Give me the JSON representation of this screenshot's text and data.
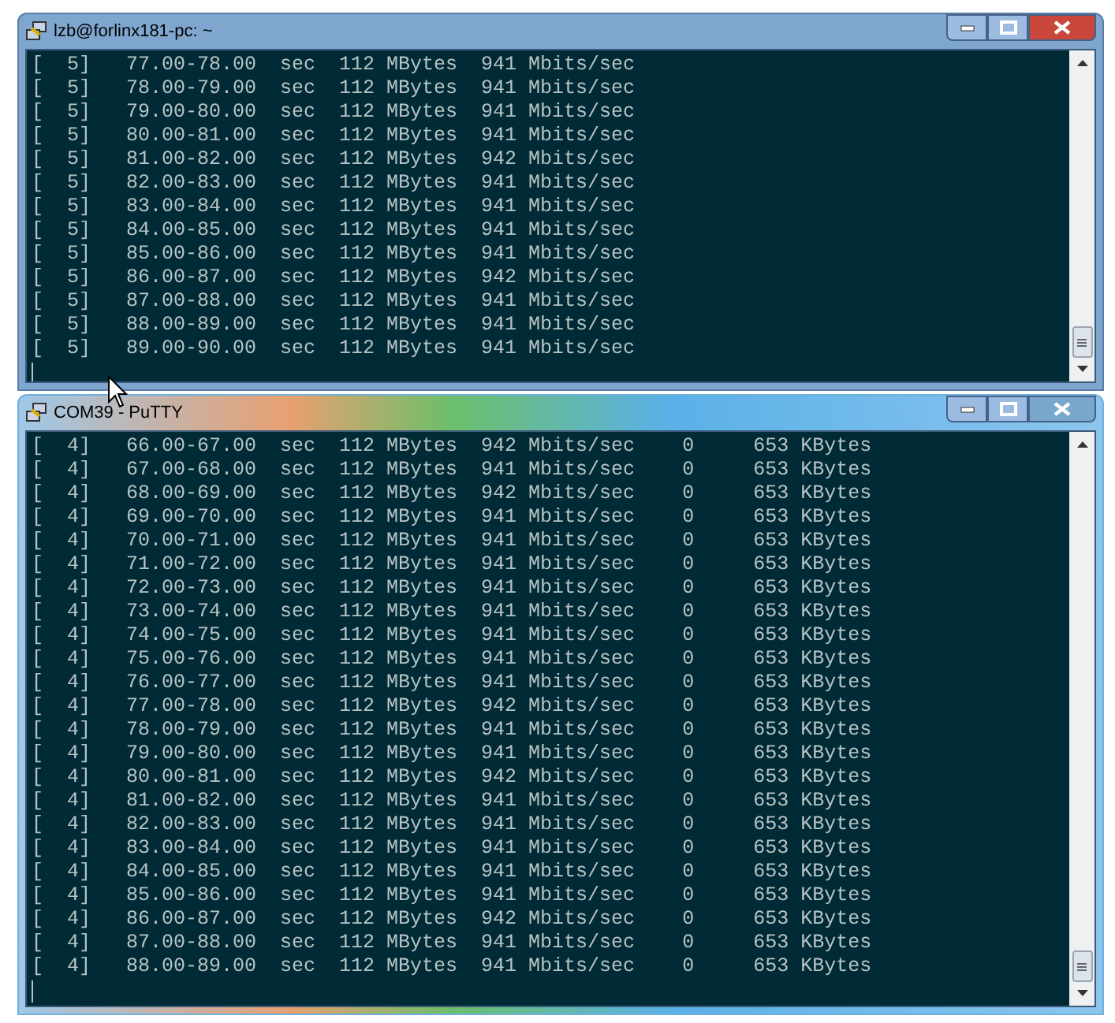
{
  "windows": [
    {
      "title": "lzb@forlinx181-pc: ~",
      "lines": [
        "[  5]   77.00-78.00  sec  112 MBytes  941 Mbits/sec",
        "[  5]   78.00-79.00  sec  112 MBytes  941 Mbits/sec",
        "[  5]   79.00-80.00  sec  112 MBytes  941 Mbits/sec",
        "[  5]   80.00-81.00  sec  112 MBytes  941 Mbits/sec",
        "[  5]   81.00-82.00  sec  112 MBytes  942 Mbits/sec",
        "[  5]   82.00-83.00  sec  112 MBytes  941 Mbits/sec",
        "[  5]   83.00-84.00  sec  112 MBytes  941 Mbits/sec",
        "[  5]   84.00-85.00  sec  112 MBytes  941 Mbits/sec",
        "[  5]   85.00-86.00  sec  112 MBytes  941 Mbits/sec",
        "[  5]   86.00-87.00  sec  112 MBytes  942 Mbits/sec",
        "[  5]   87.00-88.00  sec  112 MBytes  941 Mbits/sec",
        "[  5]   88.00-89.00  sec  112 MBytes  941 Mbits/sec",
        "[  5]   89.00-90.00  sec  112 MBytes  941 Mbits/sec"
      ]
    },
    {
      "title": "COM39 - PuTTY",
      "lines": [
        "[  4]   66.00-67.00  sec  112 MBytes  942 Mbits/sec    0     653 KBytes",
        "[  4]   67.00-68.00  sec  112 MBytes  941 Mbits/sec    0     653 KBytes",
        "[  4]   68.00-69.00  sec  112 MBytes  942 Mbits/sec    0     653 KBytes",
        "[  4]   69.00-70.00  sec  112 MBytes  941 Mbits/sec    0     653 KBytes",
        "[  4]   70.00-71.00  sec  112 MBytes  941 Mbits/sec    0     653 KBytes",
        "[  4]   71.00-72.00  sec  112 MBytes  941 Mbits/sec    0     653 KBytes",
        "[  4]   72.00-73.00  sec  112 MBytes  941 Mbits/sec    0     653 KBytes",
        "[  4]   73.00-74.00  sec  112 MBytes  941 Mbits/sec    0     653 KBytes",
        "[  4]   74.00-75.00  sec  112 MBytes  941 Mbits/sec    0     653 KBytes",
        "[  4]   75.00-76.00  sec  112 MBytes  941 Mbits/sec    0     653 KBytes",
        "[  4]   76.00-77.00  sec  112 MBytes  941 Mbits/sec    0     653 KBytes",
        "[  4]   77.00-78.00  sec  112 MBytes  942 Mbits/sec    0     653 KBytes",
        "[  4]   78.00-79.00  sec  112 MBytes  941 Mbits/sec    0     653 KBytes",
        "[  4]   79.00-80.00  sec  112 MBytes  941 Mbits/sec    0     653 KBytes",
        "[  4]   80.00-81.00  sec  112 MBytes  942 Mbits/sec    0     653 KBytes",
        "[  4]   81.00-82.00  sec  112 MBytes  941 Mbits/sec    0     653 KBytes",
        "[  4]   82.00-83.00  sec  112 MBytes  941 Mbits/sec    0     653 KBytes",
        "[  4]   83.00-84.00  sec  112 MBytes  941 Mbits/sec    0     653 KBytes",
        "[  4]   84.00-85.00  sec  112 MBytes  941 Mbits/sec    0     653 KBytes",
        "[  4]   85.00-86.00  sec  112 MBytes  941 Mbits/sec    0     653 KBytes",
        "[  4]   86.00-87.00  sec  112 MBytes  942 Mbits/sec    0     653 KBytes",
        "[  4]   87.00-88.00  sec  112 MBytes  941 Mbits/sec    0     653 KBytes",
        "[  4]   88.00-89.00  sec  112 MBytes  941 Mbits/sec    0     653 KBytes"
      ]
    }
  ]
}
